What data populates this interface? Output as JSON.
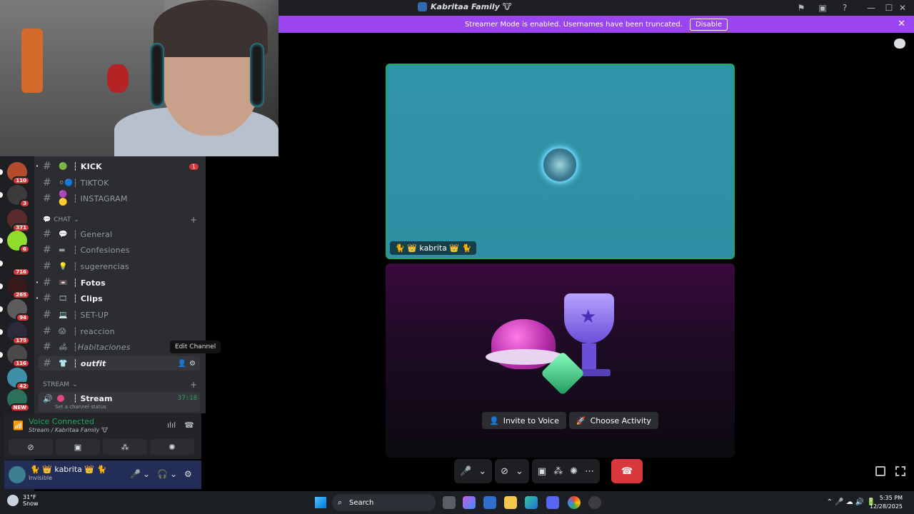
{
  "window": {
    "title": "Kabritaa Family 🐮",
    "minimize_icon": "minimize-icon",
    "maximize_icon": "maximize-icon",
    "close_icon": "close-icon"
  },
  "banner": {
    "text": "Streamer Mode is enabled. Usernames have been truncated.",
    "button": "Disable",
    "color": "#9b45f0"
  },
  "servers": [
    {
      "badge": "110",
      "color": "#b34b2f"
    },
    {
      "badge": "3",
      "color": "#3b3b3b"
    },
    {
      "badge": "371",
      "color": "#5a2b2b"
    },
    {
      "badge": "6",
      "color": "#8fdc2c"
    },
    {
      "badge": "716",
      "color": "#202020"
    },
    {
      "badge": "265",
      "color": "#3a1a1a"
    },
    {
      "badge": "94",
      "color": "#5c5c5c"
    },
    {
      "badge": "175",
      "color": "#2a2a3a"
    },
    {
      "badge": "116",
      "color": "#4a4a4a"
    },
    {
      "badge": "42",
      "color": "#3e8fa8"
    },
    {
      "badge": "NEW",
      "color": "#2c6f5a"
    }
  ],
  "channels": [
    {
      "emoji": "🟢",
      "name": "┆ KICK",
      "unread": true,
      "mention": "1"
    },
    {
      "emoji": "⚪🔵",
      "name": "┆ TIKTOK",
      "unread": false
    },
    {
      "emoji": "🟣🟡",
      "name": "┆ INSTAGRAM",
      "unread": false
    }
  ],
  "chat_category": "CHAT",
  "chat_channels": [
    {
      "emoji": "💬",
      "name": "┆ General",
      "unread": false
    },
    {
      "emoji": "▬",
      "name": "┆ Confesiones",
      "unread": false
    },
    {
      "emoji": "💡",
      "name": "┆ sugerencias",
      "unread": false
    },
    {
      "emoji": "📼",
      "name": "┆ Fotos",
      "unread": true
    },
    {
      "emoji": "🎞",
      "name": "┆ Clips",
      "unread": true
    },
    {
      "emoji": "💻",
      "name": "┆ SET-UP",
      "unread": false
    },
    {
      "emoji": "😱",
      "name": "┆ reaccion",
      "unread": false
    },
    {
      "emoji": "🛋",
      "name": "┆Habitaciones",
      "unread": false
    },
    {
      "emoji": "👕",
      "name": "┆ outfit",
      "unread": false
    }
  ],
  "tooltip": "Edit Channel",
  "stream_category": "STREAM",
  "stream_channel": {
    "name": "┆ Stream",
    "status": "Set a channel status",
    "timer": "37:18"
  },
  "voice": {
    "status": "Voice Connected",
    "location": "Stream / Kabritaa Family 🐮"
  },
  "user": {
    "name": "🐈 👑 kabrita 👑 🐈",
    "status": "Invisible"
  },
  "stage": {
    "participant": "🐈 👑 kabrita 👑 🐈",
    "invite_button": "Invite to Voice",
    "activity_button": "Choose Activity",
    "tile_color": "#3094a8",
    "speaking_color": "#23a55a"
  },
  "taskbar": {
    "temp": "31°F",
    "weather": "Snow",
    "search": "Search",
    "time": "5:35 PM",
    "date": "12/28/2025"
  }
}
